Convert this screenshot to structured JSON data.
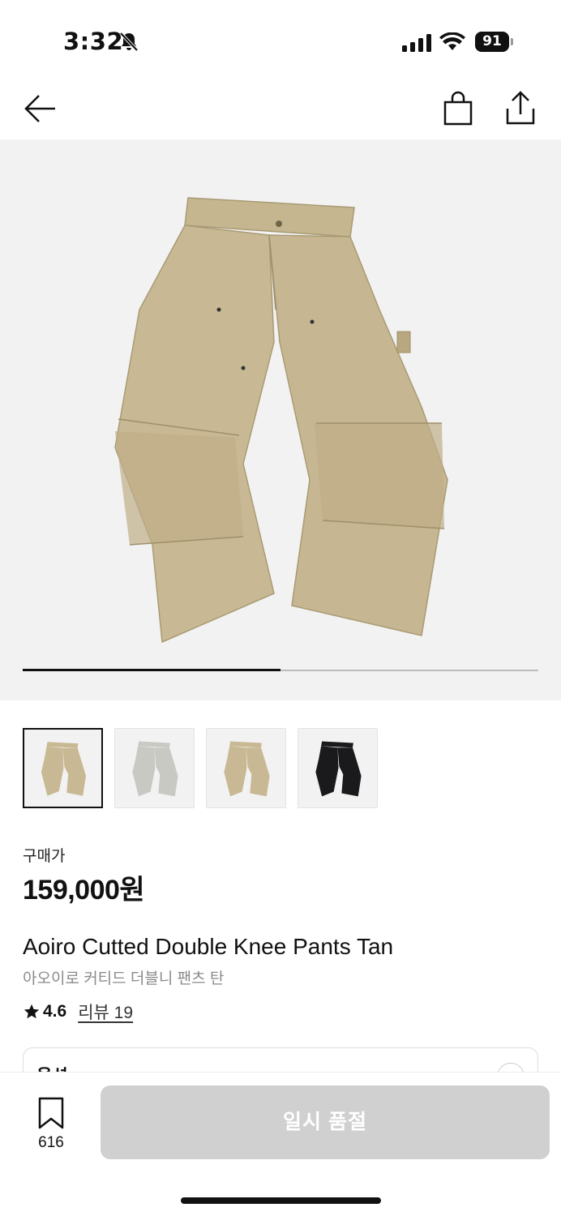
{
  "status_bar": {
    "time": "3:32",
    "battery": "91"
  },
  "nav": {
    "back_icon": "arrow-left-icon",
    "bag_icon": "shopping-bag-icon",
    "share_icon": "share-icon"
  },
  "gallery": {
    "progress_fraction": 0.5,
    "thumbnails": [
      {
        "alt": "tan",
        "color": "#c8b893"
      },
      {
        "alt": "grey",
        "color": "#c9c9c4"
      },
      {
        "alt": "tan",
        "color": "#c8b893"
      },
      {
        "alt": "black",
        "color": "#1a1a1c"
      }
    ]
  },
  "product": {
    "price_label": "구매가",
    "price": "159,000원",
    "name_en": "Aoiro Cutted Double Knee Pants Tan",
    "name_ko": "아오이로 커티드 더블니 팬츠 탄",
    "rating": "4.6",
    "review_link": "리뷰 19",
    "option_label": "옵션"
  },
  "bottom_bar": {
    "wish_count": "616",
    "buy_label": "일시 품절"
  },
  "colors": {
    "product_tan": "#c8b893",
    "button_disabled": "#d0d0d0",
    "hero_bg": "#f2f2f2"
  }
}
